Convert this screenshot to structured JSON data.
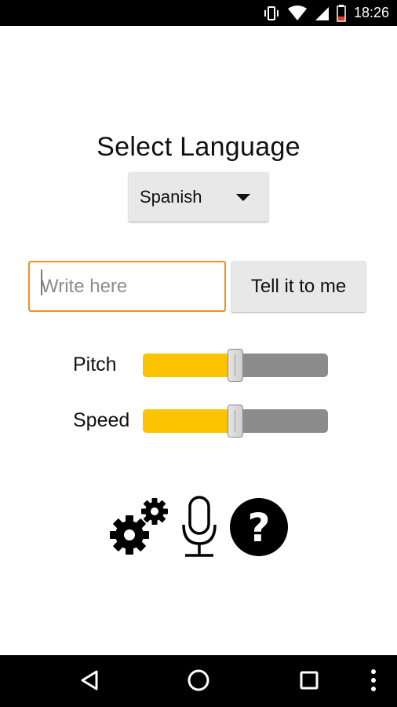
{
  "status_bar": {
    "time": "18:26",
    "icons": [
      "vibrate-icon",
      "wifi-icon",
      "signal-icon",
      "battery-icon"
    ]
  },
  "main": {
    "title": "Select Language",
    "language_selector": {
      "selected": "Spanish",
      "icon": "dropdown-arrow-icon"
    },
    "text_input": {
      "value": "",
      "placeholder": "Write here"
    },
    "speak_button": {
      "label": "Tell it to me"
    },
    "sliders": [
      {
        "label": "Pitch",
        "value_fraction": 0.5
      },
      {
        "label": "Speed",
        "value_fraction": 0.5
      }
    ],
    "action_icons": [
      "gears-icon",
      "microphone-icon",
      "help-icon"
    ]
  },
  "colors": {
    "accent": "#fcc400",
    "input_border": "#f0901f",
    "slider_track": "#8c8c8c",
    "button_bg": "#e8e8e8"
  },
  "nav_bar": {
    "buttons": [
      "back-icon",
      "home-icon",
      "recents-icon",
      "more-icon"
    ]
  }
}
